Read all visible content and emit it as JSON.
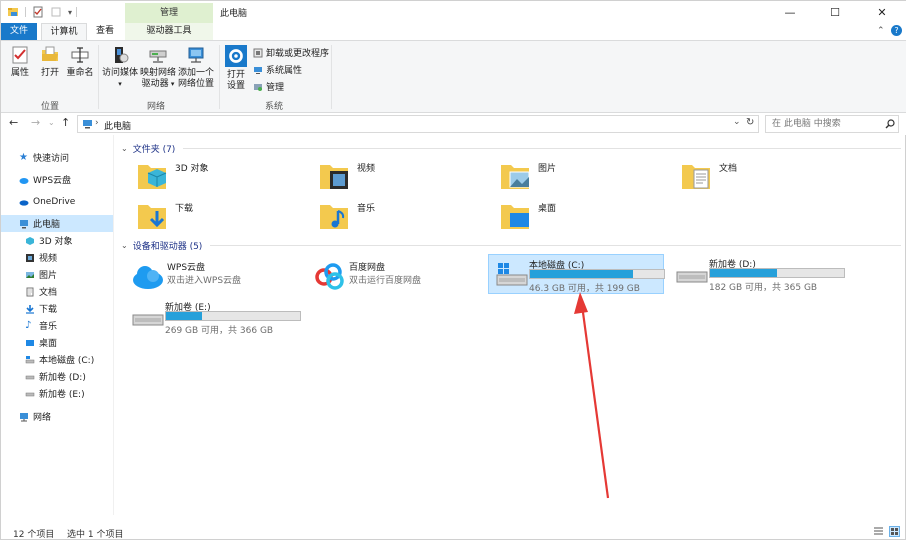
{
  "window": {
    "title": "此电脑",
    "context_tab_group": "管理",
    "controls": {
      "minimize": "—",
      "maximize": "☐",
      "close": "✕"
    }
  },
  "tabs": [
    {
      "label": "文件"
    },
    {
      "label": "计算机"
    },
    {
      "label": "查看"
    },
    {
      "label": "驱动器工具"
    }
  ],
  "ribbon": {
    "location_group": {
      "label": "位置",
      "buttons": [
        {
          "label": "属性"
        },
        {
          "label": "打开"
        },
        {
          "label": "重命名"
        }
      ]
    },
    "network_group": {
      "label": "网络",
      "buttons": [
        {
          "label1": "访问媒体",
          "label2": ""
        },
        {
          "label1": "映射网络",
          "label2": "驱动器"
        },
        {
          "label1": "添加一个",
          "label2": "网络位置"
        }
      ]
    },
    "system_group": {
      "label": "系统",
      "open_settings": {
        "label1": "打开",
        "label2": "设置"
      },
      "small_buttons": [
        {
          "label": "卸载或更改程序"
        },
        {
          "label": "系统属性"
        },
        {
          "label": "管理"
        }
      ]
    }
  },
  "address": {
    "path": "此电脑",
    "search_placeholder": "在 此电脑 中搜索"
  },
  "nav_pane": {
    "items": [
      {
        "label": "快速访问"
      },
      {
        "label": "WPS云盘"
      },
      {
        "label": "OneDrive"
      },
      {
        "label": "此电脑"
      },
      {
        "label": "3D 对象"
      },
      {
        "label": "视频"
      },
      {
        "label": "图片"
      },
      {
        "label": "文档"
      },
      {
        "label": "下载"
      },
      {
        "label": "音乐"
      },
      {
        "label": "桌面"
      },
      {
        "label": "本地磁盘 (C:)"
      },
      {
        "label": "新加卷 (D:)"
      },
      {
        "label": "新加卷 (E:)"
      },
      {
        "label": "网络"
      }
    ]
  },
  "sections": {
    "folders_header": "文件夹 (7)",
    "devices_header": "设备和驱动器 (5)"
  },
  "folders": [
    {
      "name": "3D 对象",
      "icon": "3d-objects-icon"
    },
    {
      "name": "视频",
      "icon": "video-icon"
    },
    {
      "name": "图片",
      "icon": "pictures-icon"
    },
    {
      "name": "文档",
      "icon": "documents-icon"
    },
    {
      "name": "下载",
      "icon": "downloads-icon"
    },
    {
      "name": "音乐",
      "icon": "music-icon"
    },
    {
      "name": "桌面",
      "icon": "desktop-icon"
    }
  ],
  "apps": [
    {
      "name": "WPS云盘",
      "sub": "双击进入WPS云盘"
    },
    {
      "name": "百度网盘",
      "sub": "双击运行百度网盘"
    }
  ],
  "drives": [
    {
      "name": "本地磁盘 (C:)",
      "space": "46.3 GB 可用，共 199 GB",
      "used_fraction": 0.77,
      "selected": true
    },
    {
      "name": "新加卷 (D:)",
      "space": "182 GB 可用，共 365 GB",
      "used_fraction": 0.5,
      "selected": false
    },
    {
      "name": "新加卷 (E:)",
      "space": "269 GB 可用，共 366 GB",
      "used_fraction": 0.27,
      "selected": false
    }
  ],
  "status": {
    "count": "12 个项目",
    "selection": "选中 1 个项目"
  },
  "colors": {
    "accent": "#1979ca",
    "selection": "#cce8ff",
    "drive_bar": "#26a0da",
    "annotation_arrow": "#e53935"
  }
}
